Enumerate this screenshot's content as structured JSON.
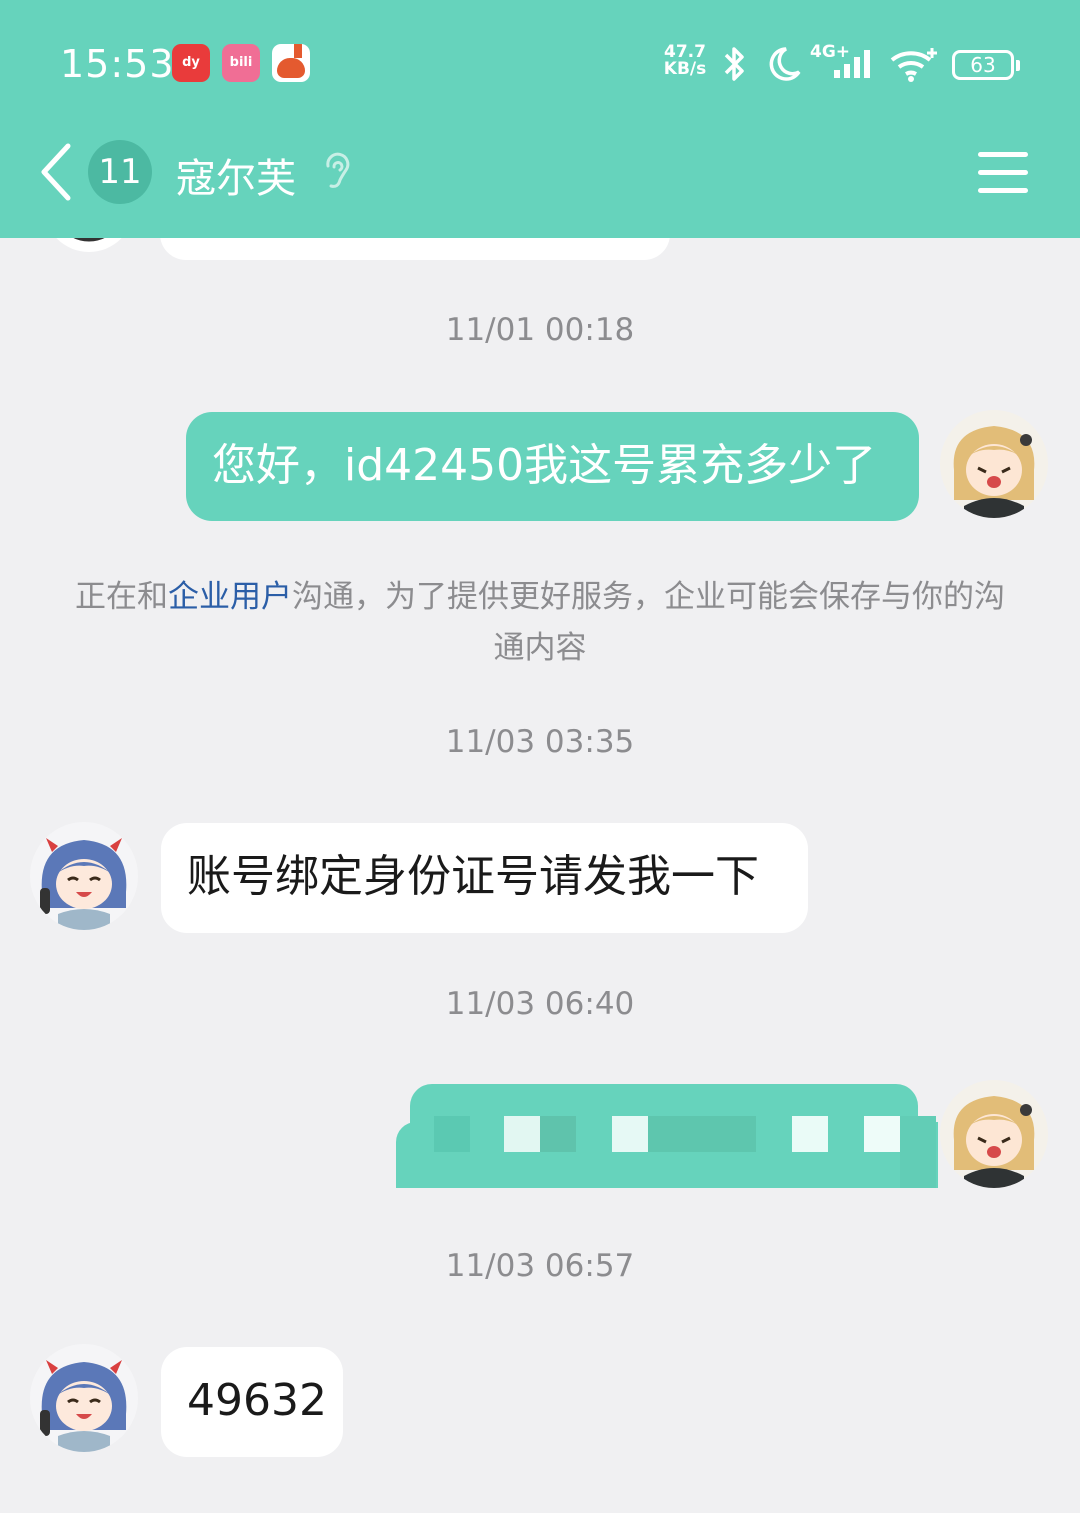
{
  "status_bar": {
    "time": "15:53",
    "apps": [
      "dy-ai-app-icon",
      "bilibili-app-icon",
      "tomato-novel-app-icon"
    ],
    "app_labels": {
      "ai": "dy",
      "bili": "bili"
    },
    "net_speed_value": "47.7",
    "net_speed_unit": "KB/s",
    "network_type": "4G+",
    "battery": "63"
  },
  "header": {
    "unread_count": "11",
    "title": "寇尔芙"
  },
  "messages": [
    {
      "type": "timestamp",
      "text": "11/01 00:18"
    },
    {
      "type": "outgoing",
      "text": "您好，id42450我这号累充多少了"
    },
    {
      "type": "timestamp",
      "text": "11/03 03:35"
    },
    {
      "type": "incoming",
      "text": "账号绑定身份证号请发我一下"
    },
    {
      "type": "timestamp",
      "text": "11/03 06:40"
    },
    {
      "type": "outgoing-censored",
      "text": ""
    },
    {
      "type": "timestamp",
      "text": "11/03 06:57"
    },
    {
      "type": "incoming",
      "text": "49632"
    }
  ],
  "system_notice": {
    "prefix": "正在和",
    "link": "企业用户",
    "suffix": "沟通，为了提供更好服务，企业可能会保存与你的沟通内容"
  },
  "colors": {
    "accent": "#66d3bc",
    "background": "#f0f0f2",
    "link": "#2b5ea7"
  }
}
